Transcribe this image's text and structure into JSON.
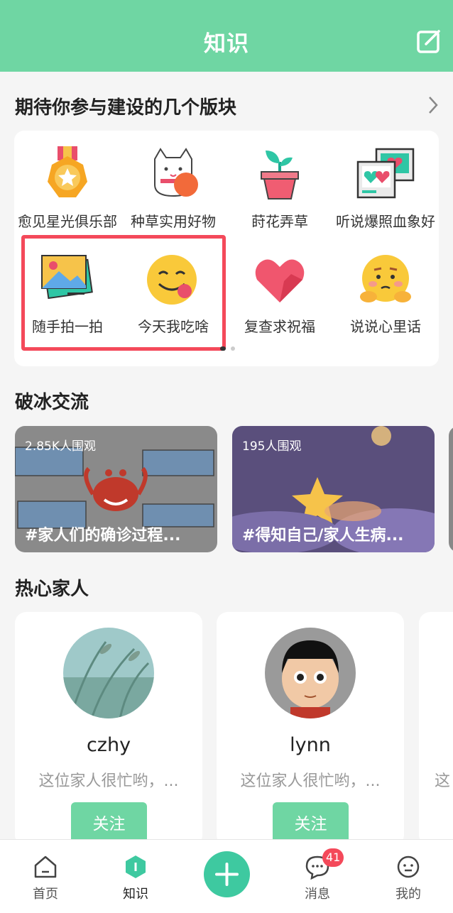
{
  "header": {
    "title": "知识"
  },
  "categories_section": {
    "title": "期待你参与建设的几个版块",
    "items": [
      {
        "label": "愈见星光俱乐部",
        "icon": "medal-icon"
      },
      {
        "label": "种草实用好物",
        "icon": "lucky-cat-icon"
      },
      {
        "label": "莳花弄草",
        "icon": "potted-plant-icon"
      },
      {
        "label": "听说爆照血象好",
        "icon": "photo-hearts-icon"
      },
      {
        "label": "随手拍一拍",
        "icon": "picture-icon"
      },
      {
        "label": "今天我吃啥",
        "icon": "yum-face-icon"
      },
      {
        "label": "复查求祝福",
        "icon": "heart-icon"
      },
      {
        "label": "说说心里话",
        "icon": "shy-face-icon"
      }
    ]
  },
  "icebreak_section": {
    "title": "破冰交流",
    "cards": [
      {
        "viewers": "2.85K人围观",
        "title": "#家人们的确诊过程..."
      },
      {
        "viewers": "195人围观",
        "title": "#得知自己/家人生病..."
      }
    ]
  },
  "family_section": {
    "title": "热心家人",
    "cards": [
      {
        "name": "czhy",
        "desc": "这位家人很忙哟，...",
        "follow": "关注"
      },
      {
        "name": "lynn",
        "desc": "这位家人很忙哟，...",
        "follow": "关注"
      }
    ],
    "peek_desc": "这"
  },
  "bottom_nav": {
    "items": [
      {
        "label": "首页"
      },
      {
        "label": "知识"
      },
      {
        "label": "消息",
        "badge": "41"
      },
      {
        "label": "我的"
      }
    ]
  },
  "colors": {
    "brand": "#6fd6a3",
    "accent": "#3ec9a0",
    "highlight": "#f4495a"
  }
}
